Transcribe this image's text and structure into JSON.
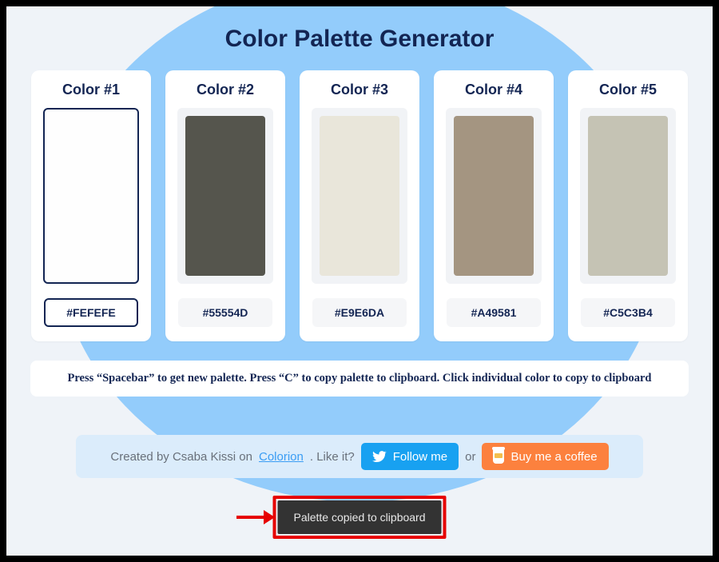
{
  "title": "Color Palette Generator",
  "colors": [
    {
      "label": "Color #1",
      "hex": "#FEFEFE",
      "swatch": "#fefefe",
      "selected": true
    },
    {
      "label": "Color #2",
      "hex": "#55554D",
      "swatch": "#55554d",
      "selected": false
    },
    {
      "label": "Color #3",
      "hex": "#E9E6DA",
      "swatch": "#e9e6da",
      "selected": false
    },
    {
      "label": "Color #4",
      "hex": "#A49581",
      "swatch": "#a49581",
      "selected": false
    },
    {
      "label": "Color #5",
      "hex": "#C5C3B4",
      "swatch": "#c5c3b4",
      "selected": false
    }
  ],
  "instructions": "Press “Spacebar” to get new palette. Press “C” to copy palette to clipboard. Click individual color to copy to clipboard",
  "footer": {
    "created_prefix": "Created by Csaba Kissi on ",
    "link_text": "Colorion",
    "like_it": ". Like it?",
    "follow_label": "Follow me",
    "or": "or",
    "coffee_label": "Buy me a coffee"
  },
  "toast": "Palette copied to clipboard"
}
